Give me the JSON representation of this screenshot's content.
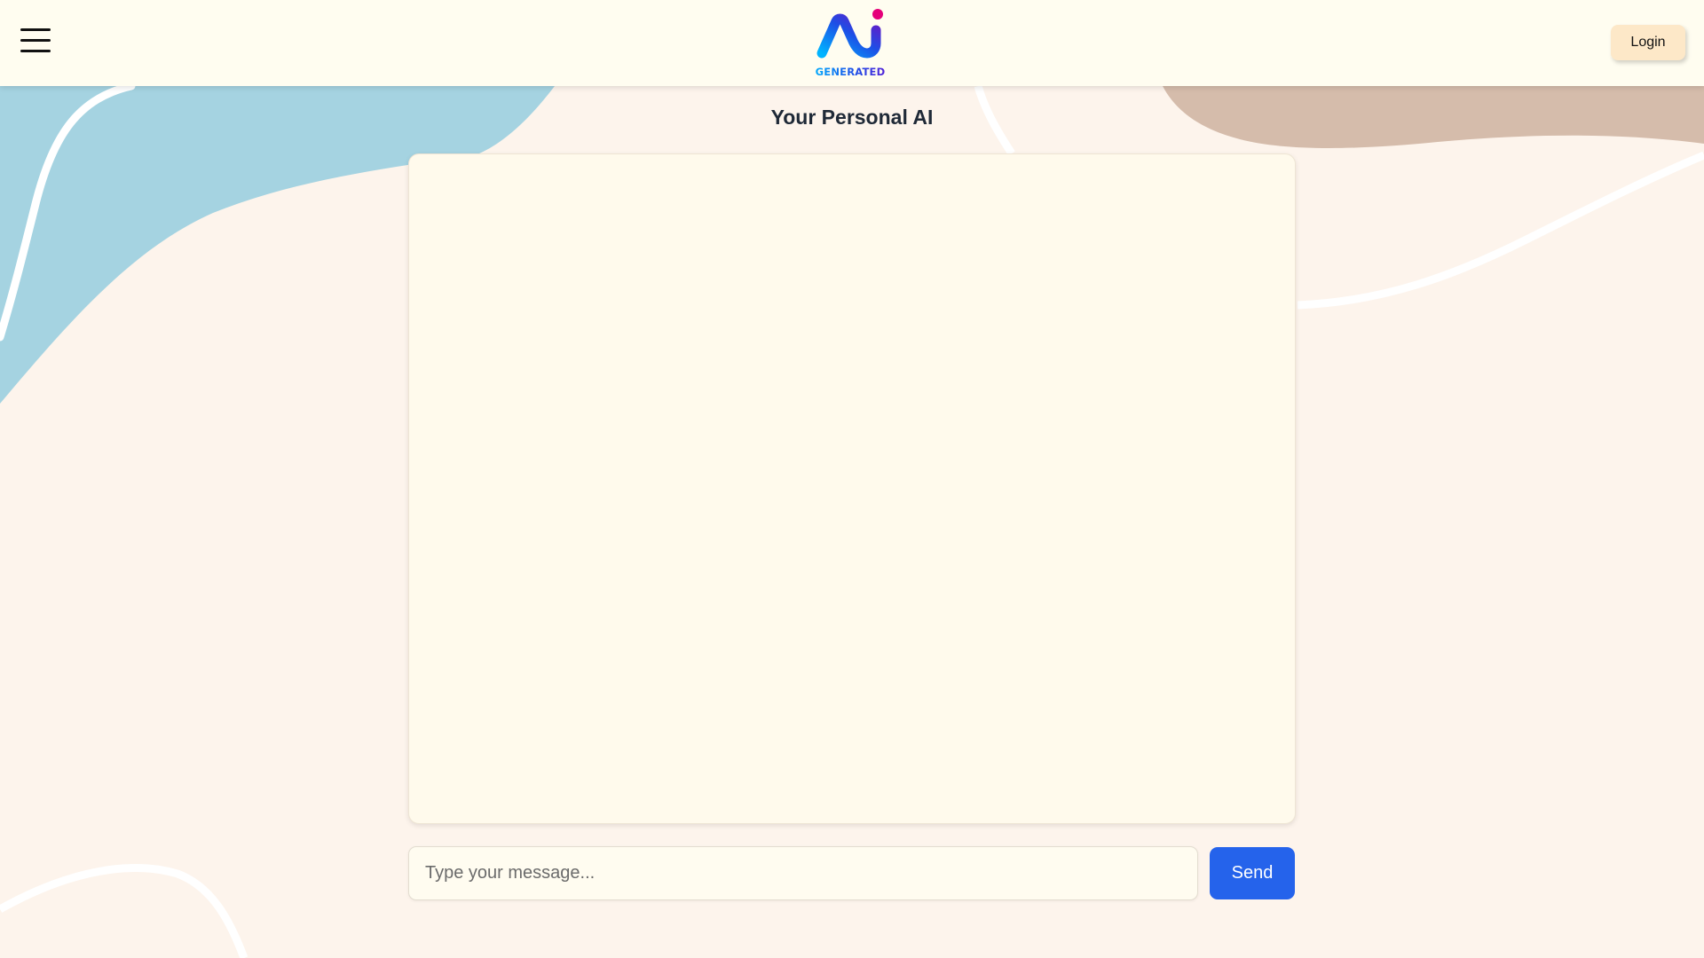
{
  "header": {
    "menu_icon": "hamburger-menu-icon",
    "logo_text": "GENERATED",
    "login_label": "Login"
  },
  "main": {
    "title": "Your Personal AI",
    "chat_messages": []
  },
  "composer": {
    "placeholder": "Type your message...",
    "value": "",
    "send_label": "Send"
  },
  "colors": {
    "header_bg": "#fffdf0",
    "page_bg": "#fdf4ec",
    "chat_bg": "#fffaec",
    "send_button": "#2563eb",
    "login_button": "#fde8c8",
    "blob_blue": "#a5d3e1",
    "blob_tan": "#d5bcab"
  }
}
